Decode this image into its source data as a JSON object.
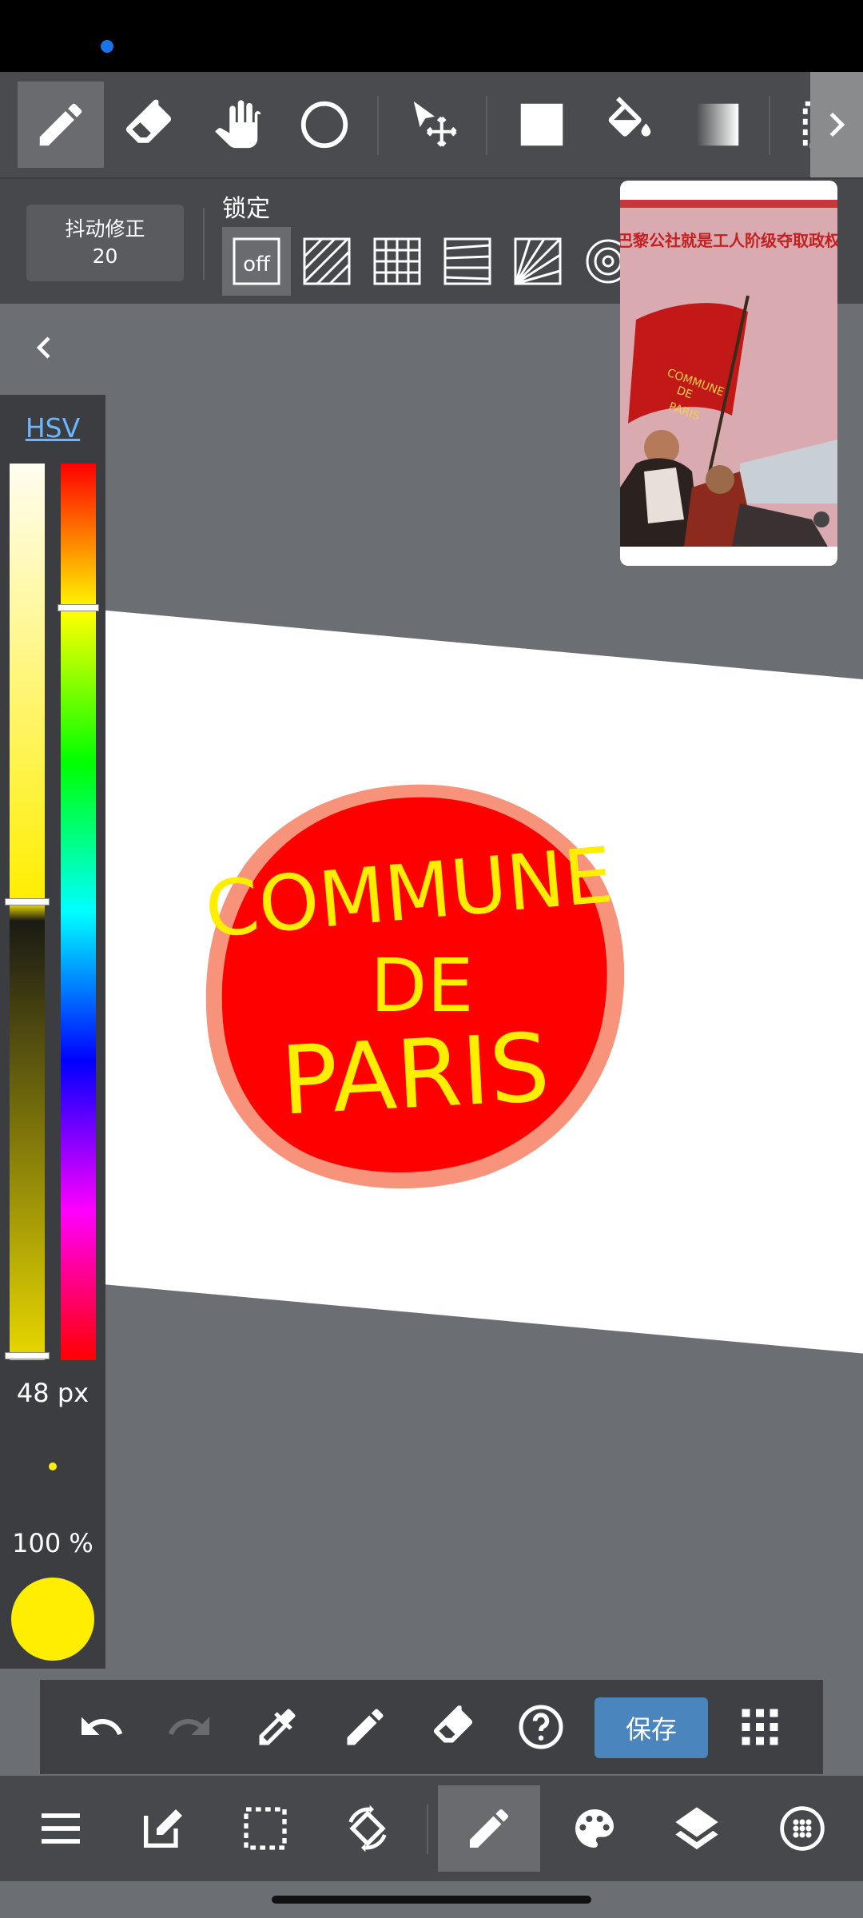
{
  "stabilizer": {
    "label": "抖动修正",
    "value": "20"
  },
  "lock": {
    "label": "锁定",
    "off_label": "off"
  },
  "color_panel": {
    "mode_tab": "HSV",
    "brush_size": "48 px",
    "opacity": "100 %",
    "current_color": "#ffee00"
  },
  "drawing": {
    "line1": "COMMUNE",
    "line2": "DE",
    "line3": "PARIS",
    "fill_color": "#ff0000",
    "outline_color": "#f7937a",
    "text_color": "#ffee00"
  },
  "reference": {
    "caption": "巴黎公社就是工人阶级夺取政权",
    "flag_text_1": "COMMUNE",
    "flag_text_2": "DE",
    "flag_text_3": "PARIS"
  },
  "actions": {
    "save_label": "保存"
  },
  "icons": {
    "toolbar": [
      "pen-icon",
      "eraser-icon",
      "hand-icon",
      "circle-icon",
      "move-icon",
      "fill-rect-icon",
      "bucket-icon",
      "gradient-icon",
      "selection-icon"
    ],
    "action_bar": [
      "undo-icon",
      "redo-icon",
      "eyedropper-icon",
      "pen-icon",
      "eraser-icon",
      "help-icon",
      "grid-dots-icon"
    ],
    "bottom_nav": [
      "menu-icon",
      "edit-icon",
      "selection-icon",
      "rotate-icon",
      "brush-icon",
      "palette-icon",
      "layers-icon",
      "settings-icon"
    ]
  }
}
